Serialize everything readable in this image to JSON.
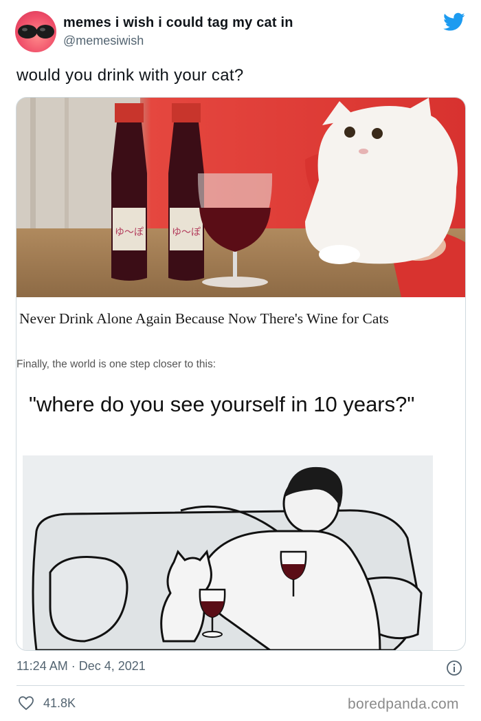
{
  "author": {
    "name": "memes i wish i could tag my cat in",
    "handle": "@memesiwish"
  },
  "tweet": {
    "text": "would you drink with your cat?"
  },
  "media": {
    "headline": "Never Drink Alone Again Because Now There's Wine for Cats",
    "subline": "Finally, the world is one step closer to this:",
    "meme_caption": "\"where do you see yourself in 10 years?\"",
    "bottle_label": "ゆ〜ぽ"
  },
  "meta": {
    "timestamp": "11:24 AM · Dec 4, 2021",
    "likes": "41.8K"
  },
  "watermark": "boredpanda.com",
  "colors": {
    "twitter_blue": "#1d9bf0",
    "secondary_text": "#536471",
    "divider": "#cfd9de"
  },
  "icons": [
    "twitter-bird-icon",
    "info-icon",
    "heart-icon"
  ]
}
